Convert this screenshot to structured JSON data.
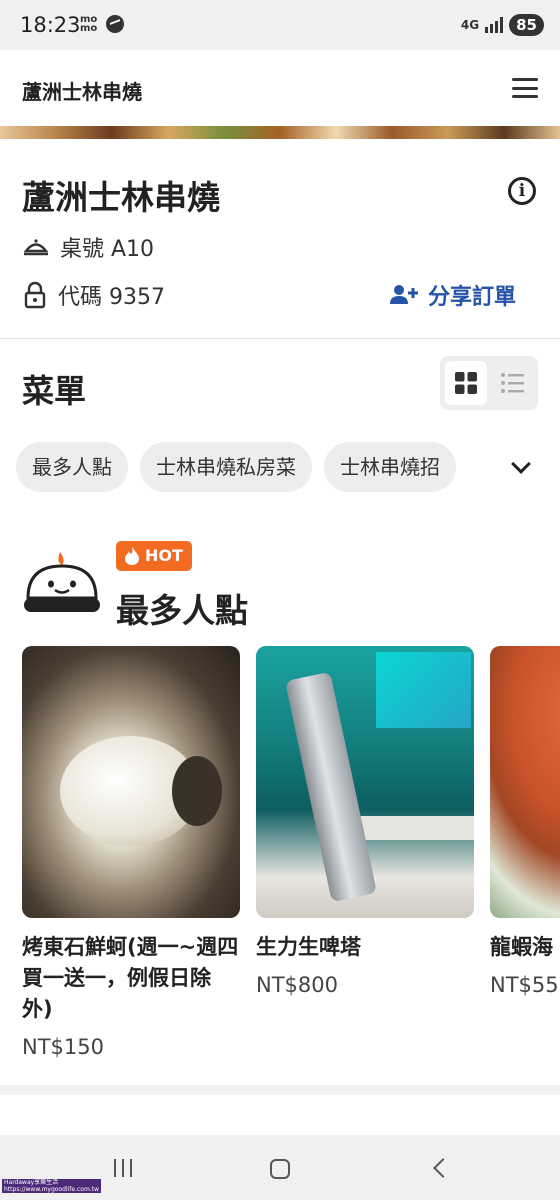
{
  "status_bar": {
    "time": "18:23",
    "app_badge": "mo mo",
    "network": "4G",
    "battery": "85"
  },
  "header": {
    "title": "蘆洲士林串燒"
  },
  "restaurant": {
    "name": "蘆洲士林串燒",
    "table_label": "桌號 A10",
    "code_label": "代碼 9357",
    "share_label": "分享訂單"
  },
  "menu": {
    "title": "菜單",
    "categories": [
      "最多人點",
      "士林串燒私房菜",
      "士林串燒招"
    ]
  },
  "popular": {
    "badge": "HOT",
    "title": "最多人點",
    "items": [
      {
        "name": "烤東石鮮蚵(週一~週四買一送一，例假日除外)",
        "price": "NT$150"
      },
      {
        "name": "生力生啤塔",
        "price": "NT$800"
      },
      {
        "name": "龍蝦海",
        "price": "NT$55"
      }
    ]
  },
  "watermark": {
    "line1": "Hardaway享樂生活",
    "line2": "https://www.mygoodlife.com.tw"
  },
  "colors": {
    "accent": "#2553a5",
    "hot": "#f26b21",
    "chip_bg": "#ededed"
  }
}
